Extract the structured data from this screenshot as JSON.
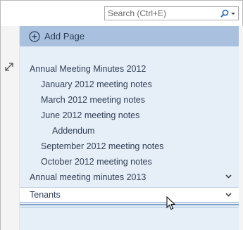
{
  "search": {
    "placeholder": "Search (Ctrl+E)"
  },
  "toolbar": {
    "add_page_label": "Add Page"
  },
  "pages": [
    {
      "label": "Annual Meeting Minutes 2012",
      "level": 0
    },
    {
      "label": "January 2012 meeting notes",
      "level": 1
    },
    {
      "label": "March 2012 meeting notes",
      "level": 1
    },
    {
      "label": "June 2012 meeting notes",
      "level": 1
    },
    {
      "label": "Addendum",
      "level": 2
    },
    {
      "label": "September 2012 meeting notes",
      "level": 1
    },
    {
      "label": "October 2012 meeting notes",
      "level": 1
    },
    {
      "label": "Annual meeting minutes 2013",
      "level": 0
    }
  ],
  "dragged_page": {
    "label": "Tenants"
  },
  "colors": {
    "add_page_bar": "#a9c1df",
    "panel_bg": "#e6eef7",
    "text": "#2f3f57",
    "search_icon": "#2b6cb0"
  },
  "icons": {
    "search": "search-icon",
    "expand": "expand-arrows-icon",
    "add": "add-circle-icon",
    "chevron": "chevron-down-icon",
    "cursor": "mouse-pointer-icon"
  }
}
